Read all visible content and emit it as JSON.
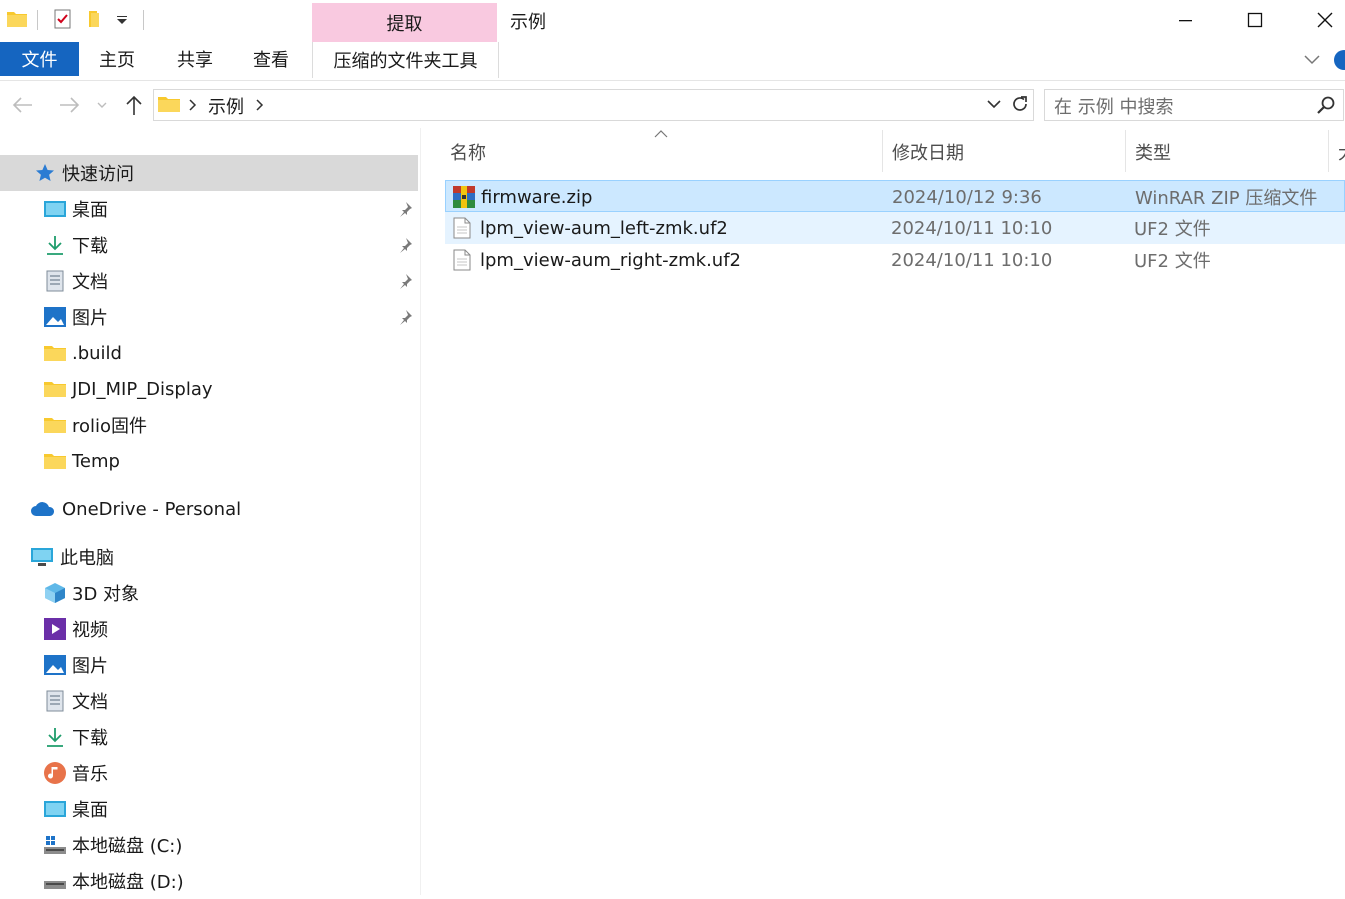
{
  "title": "示例",
  "context_tab_header": "提取",
  "ribbon_tabs": [
    "文件",
    "主页",
    "共享",
    "查看",
    "压缩的文件夹工具"
  ],
  "address": {
    "crumb": "示例"
  },
  "search": {
    "placeholder": "在 示例 中搜索"
  },
  "nav": {
    "quick_access": {
      "label": "快速访问",
      "items": [
        {
          "label": "桌面",
          "icon": "desktop-icon",
          "pinned": true
        },
        {
          "label": "下载",
          "icon": "download-icon",
          "pinned": true
        },
        {
          "label": "文档",
          "icon": "document-icon",
          "pinned": true
        },
        {
          "label": "图片",
          "icon": "picture-icon",
          "pinned": true
        },
        {
          "label": ".build",
          "icon": "folder-icon",
          "pinned": false
        },
        {
          "label": "JDI_MIP_Display",
          "icon": "folder-icon",
          "pinned": false
        },
        {
          "label": "rolio固件",
          "icon": "folder-icon",
          "pinned": false
        },
        {
          "label": "Temp",
          "icon": "folder-icon",
          "pinned": false
        }
      ]
    },
    "onedrive": {
      "label": "OneDrive - Personal"
    },
    "this_pc": {
      "label": "此电脑",
      "items": [
        {
          "label": "3D 对象",
          "icon": "3d-objects-icon"
        },
        {
          "label": "视频",
          "icon": "video-icon"
        },
        {
          "label": "图片",
          "icon": "picture-icon"
        },
        {
          "label": "文档",
          "icon": "document-icon"
        },
        {
          "label": "下载",
          "icon": "download-icon"
        },
        {
          "label": "音乐",
          "icon": "music-icon"
        },
        {
          "label": "桌面",
          "icon": "desktop-icon"
        },
        {
          "label": "本地磁盘 (C:)",
          "icon": "windows-drive-icon"
        },
        {
          "label": "本地磁盘 (D:)",
          "icon": "drive-icon"
        }
      ]
    }
  },
  "columns": {
    "name": "名称",
    "modified": "修改日期",
    "type": "类型",
    "size": "大"
  },
  "files": [
    {
      "name": "firmware.zip",
      "modified": "2024/10/12 9:36",
      "type": "WinRAR ZIP 压缩文件",
      "icon": "winrar-zip-icon"
    },
    {
      "name": "lpm_view-aum_left-zmk.uf2",
      "modified": "2024/10/11 10:10",
      "type": "UF2 文件",
      "icon": "file-icon"
    },
    {
      "name": "lpm_view-aum_right-zmk.uf2",
      "modified": "2024/10/11 10:10",
      "type": "UF2 文件",
      "icon": "file-icon"
    }
  ],
  "colors": {
    "accent": "#1565c0",
    "context_tab": "#f9c9e0",
    "selected_row": "#cce8ff",
    "hover_row": "#e5f3ff"
  }
}
